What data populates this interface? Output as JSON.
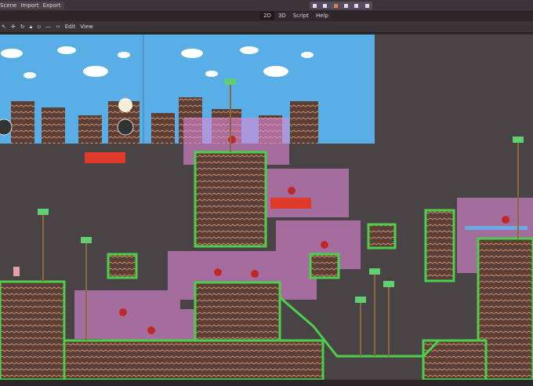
{
  "menu": {
    "items": [
      "Scene",
      "Import",
      "Export"
    ]
  },
  "workspace_tabs": [
    "2D",
    "3D",
    "Script",
    "Help"
  ],
  "active_tab": "2D",
  "play_controls": [
    "play-icon",
    "stop-icon",
    "play-scene-icon",
    "debug-icon",
    "deploy-icon",
    "settings-icon"
  ],
  "toolbar": {
    "icons": [
      "select-icon",
      "move-icon",
      "rotate-icon",
      "lock-icon",
      "unlock-icon",
      "group-icon",
      "ungroup-icon"
    ],
    "edit": "Edit",
    "view": "View"
  },
  "colors": {
    "sky": "#5aaee6",
    "ground": "#5b3f36",
    "grass": "#4bd04b",
    "area": "#e08ad8",
    "hazard": "#e03a2a"
  }
}
